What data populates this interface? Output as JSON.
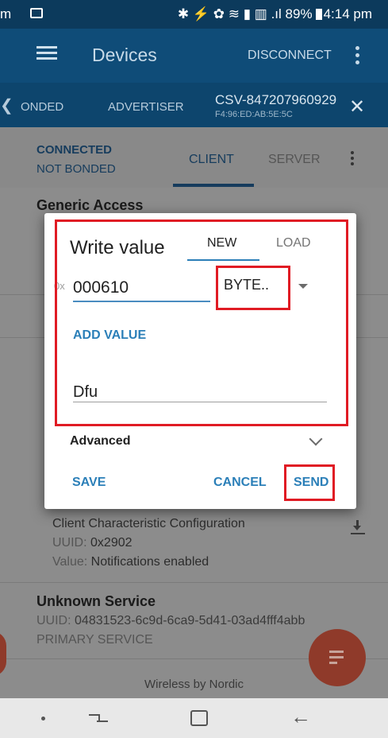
{
  "status_bar": {
    "left_fragment": "m",
    "right_text": "89%",
    "time": "4:14 pm"
  },
  "app_bar": {
    "title": "Devices",
    "disconnect_label": "DISCONNECT"
  },
  "device_tabs": {
    "tab_bonded": "ONDED",
    "tab_advertiser": "ADVERTISER",
    "device_name": "CSV-847207960929",
    "device_mac": "F4:96:ED:AB:5E:5C"
  },
  "connection": {
    "state": "CONNECTED",
    "bond": "NOT BONDED"
  },
  "sub_tabs": {
    "client": "CLIENT",
    "server": "SERVER"
  },
  "background_list": {
    "generic_access": "Generic Access",
    "descriptor_name": "Client Characteristic Configuration",
    "descriptor_uuid_label": "UUID:",
    "descriptor_uuid": "0x2902",
    "descriptor_value_label": "Value:",
    "descriptor_value": "Notifications enabled",
    "unknown_service": "Unknown Service",
    "service_uuid_label": "UUID:",
    "service_uuid": "04831523-6c9d-6ca9-5d41-03ad4fff4abb",
    "service_type": "PRIMARY SERVICE"
  },
  "footer": {
    "text": "Wireless by Nordic"
  },
  "dialog": {
    "title": "Write value",
    "tab_new": "NEW",
    "tab_load": "LOAD",
    "hex_prefix": "0x",
    "hex_value": "000610",
    "type_selected": "BYTE..",
    "add_value_label": "ADD VALUE",
    "text_value": "Dfu",
    "advanced_label": "Advanced",
    "save_label": "SAVE",
    "cancel_label": "CANCEL",
    "send_label": "SEND"
  },
  "colors": {
    "app_bar": "#0f4c78",
    "accent": "#2b7fb8",
    "highlight": "#e01b24",
    "fab": "#8f3a2a"
  }
}
